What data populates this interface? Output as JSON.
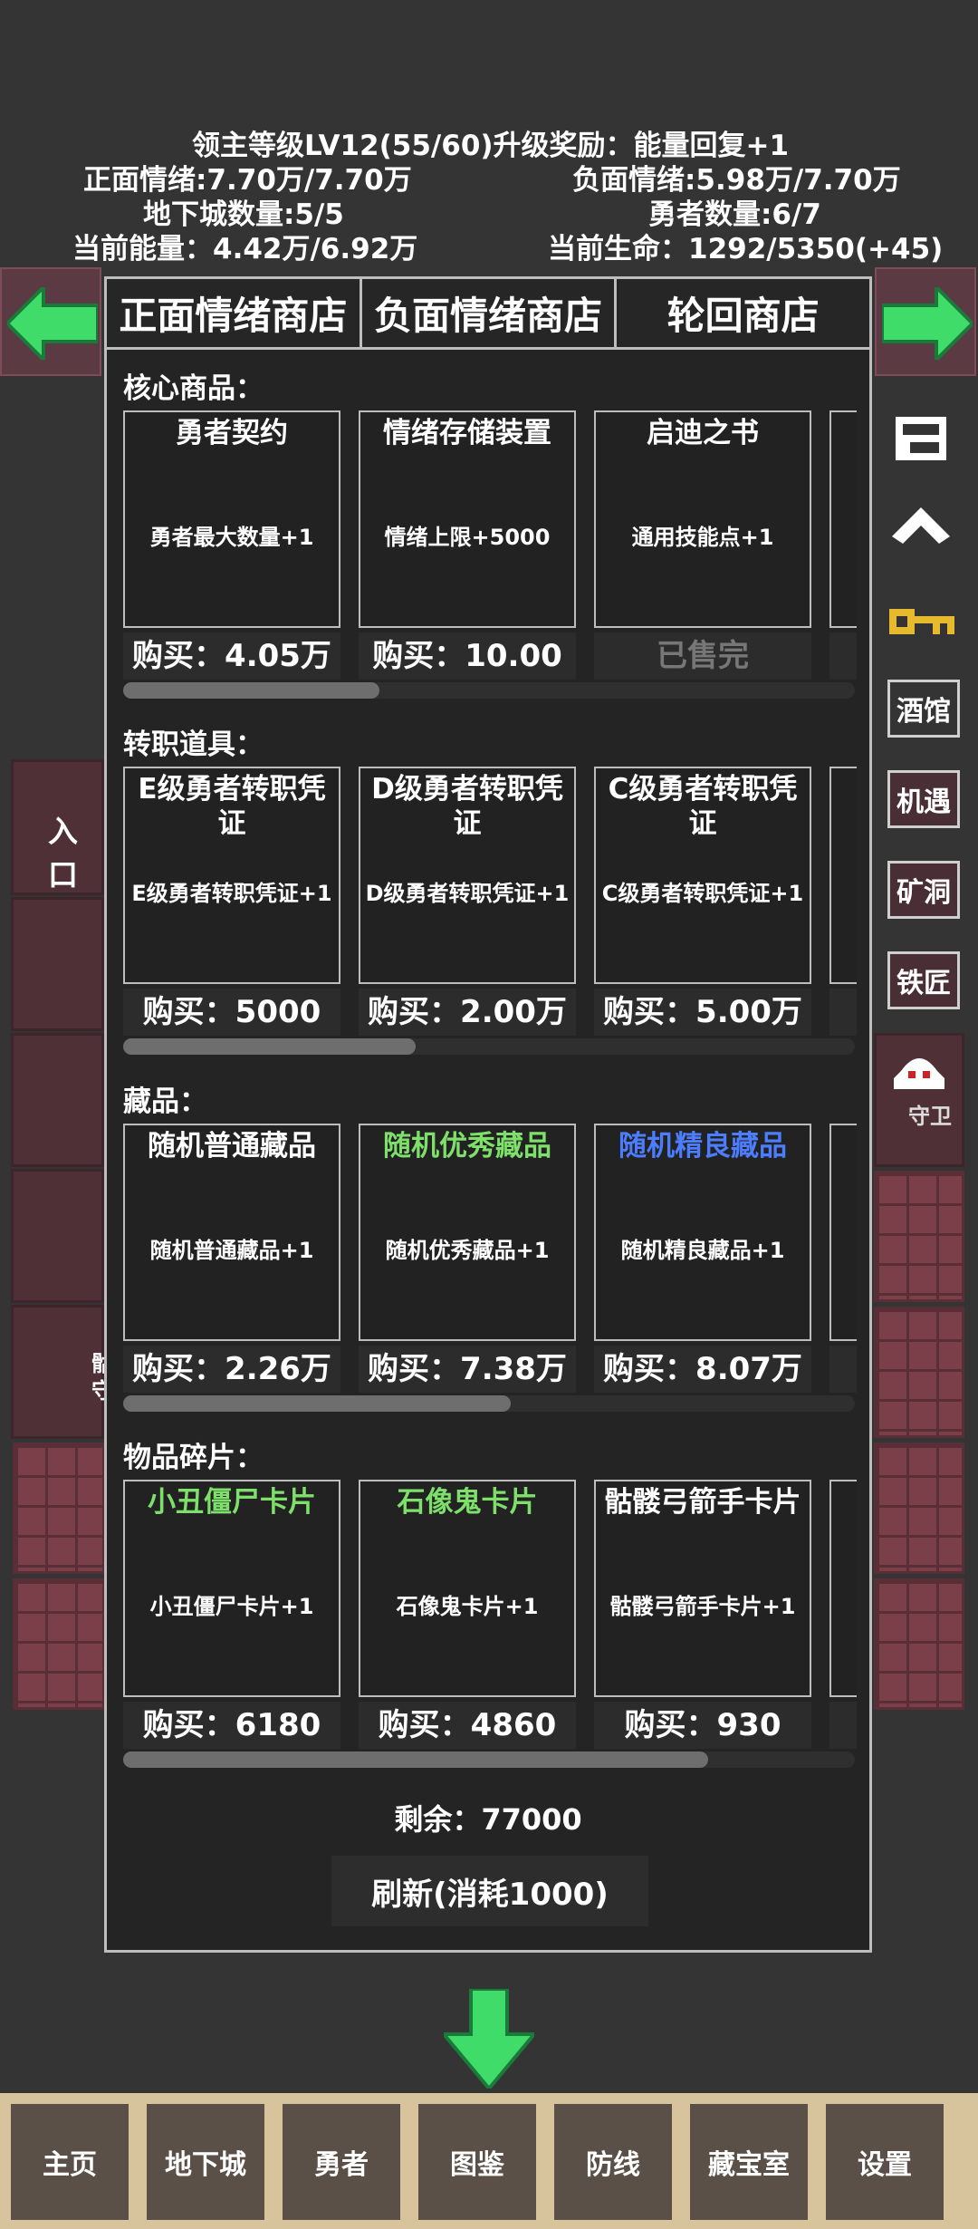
{
  "stats": {
    "lord_level": "领主等级LV12(55/60)升级奖励：能量回复+1",
    "positive": "正面情绪:7.70万/7.70万",
    "negative": "负面情绪:5.98万/7.70万",
    "dungeon_count": "地下城数量:5/5",
    "hero_count": "勇者数量:6/7",
    "energy": "当前能量：4.42万/6.92万",
    "life": "当前生命：1292/5350(+45)"
  },
  "tabs": [
    "正面情绪商店",
    "负面情绪商店",
    "轮回商店"
  ],
  "sections": [
    {
      "title": "核心商品：",
      "scroll": 0.35,
      "items": [
        {
          "name": "勇者契约",
          "name_color": "#ffffff",
          "desc": "勇者最大数量+1",
          "price": "购买：4.05万",
          "sold": false
        },
        {
          "name": "情绪存储装置",
          "name_color": "#ffffff",
          "desc": "情绪上限+5000",
          "price": "购买：10.00万",
          "sold": false
        },
        {
          "name": "启迪之书",
          "name_color": "#ffffff",
          "desc": "通用技能点+1",
          "price": "已售完",
          "sold": true
        }
      ]
    },
    {
      "title": "转职道具：",
      "scroll": 0.4,
      "items": [
        {
          "name": "E级勇者转职凭证",
          "name_color": "#ffffff",
          "desc": "E级勇者转职凭证+1",
          "price": "购买：5000",
          "sold": false
        },
        {
          "name": "D级勇者转职凭证",
          "name_color": "#ffffff",
          "desc": "D级勇者转职凭证+1",
          "price": "购买：2.00万",
          "sold": false
        },
        {
          "name": "C级勇者转职凭证",
          "name_color": "#ffffff",
          "desc": "C级勇者转职凭证+1",
          "price": "购买：5.00万",
          "sold": false
        }
      ]
    },
    {
      "title": "藏品：",
      "scroll": 0.53,
      "items": [
        {
          "name": "随机普通藏品",
          "name_color": "#ffffff",
          "desc": "随机普通藏品+1",
          "price": "购买：2.26万",
          "sold": false
        },
        {
          "name": "随机优秀藏品",
          "name_color": "#7ee06a",
          "desc": "随机优秀藏品+1",
          "price": "购买：7.38万",
          "sold": false
        },
        {
          "name": "随机精良藏品",
          "name_color": "#4d7dff",
          "desc": "随机精良藏品+1",
          "price": "购买：8.07万",
          "sold": false
        }
      ]
    },
    {
      "title": "物品碎片：",
      "scroll": 0.8,
      "items": [
        {
          "name": "小丑僵尸卡片",
          "name_color": "#7ee06a",
          "desc": "小丑僵尸卡片+1",
          "price": "购买：6180",
          "sold": false
        },
        {
          "name": "石像鬼卡片",
          "name_color": "#7ee06a",
          "desc": "石像鬼卡片+1",
          "price": "购买：4860",
          "sold": false
        },
        {
          "name": "骷髅弓箭手卡片",
          "name_color": "#ffffff",
          "desc": "骷髅弓箭手卡片+1",
          "price": "购买：930",
          "sold": false
        }
      ]
    }
  ],
  "remaining": "剩余：77000",
  "refresh_label": "刷新(消耗1000)",
  "side_buttons": [
    "酒馆",
    "机遇",
    "矿洞",
    "铁匠"
  ],
  "guard_label": "守卫",
  "map_labels": {
    "entrance": "入口",
    "skeleton": "骷",
    "guard": "守"
  },
  "nav": [
    "主页",
    "地下城",
    "勇者",
    "图鉴",
    "防线",
    "藏宝室",
    "设置"
  ],
  "colors": {
    "accent_green": "#3fdc6a",
    "rare_blue": "#4d7dff",
    "uncommon_green": "#7ee06a"
  }
}
